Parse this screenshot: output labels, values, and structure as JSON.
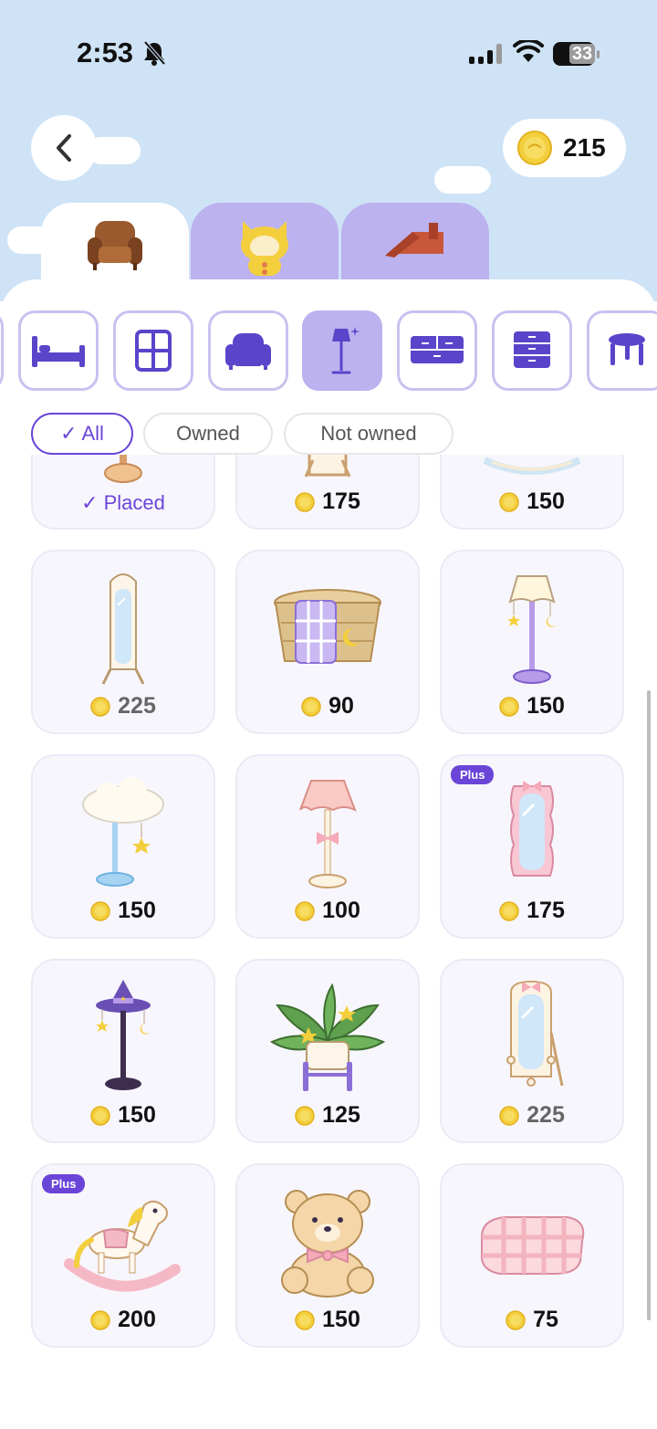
{
  "status_bar": {
    "time": "2:53",
    "battery": "33"
  },
  "header": {
    "coins": "215"
  },
  "tabs": [
    {
      "icon": "armchair-icon",
      "active": true
    },
    {
      "icon": "cat-avatar-icon",
      "active": false
    },
    {
      "icon": "roof-icon",
      "active": false
    }
  ],
  "categories": [
    {
      "icon": "bed-icon",
      "active": false
    },
    {
      "icon": "window-icon",
      "active": false
    },
    {
      "icon": "sofa-icon",
      "active": false
    },
    {
      "icon": "floor-lamp-icon",
      "active": true
    },
    {
      "icon": "dresser-icon",
      "active": false
    },
    {
      "icon": "cabinet-icon",
      "active": false
    },
    {
      "icon": "stool-icon",
      "active": false
    }
  ],
  "filters": {
    "all": "✓ All",
    "owned": "Owned",
    "not_owned": "Not owned"
  },
  "items": [
    {
      "icon": "lamp-base-item",
      "placed_label": "✓ Placed"
    },
    {
      "icon": "frame-mirror-item",
      "price": "175"
    },
    {
      "icon": "round-mirror-item",
      "price": "150"
    },
    {
      "icon": "standing-mirror-item",
      "price": "225"
    },
    {
      "icon": "blanket-basket-item",
      "price": "90"
    },
    {
      "icon": "star-moon-floor-lamp-item",
      "price": "150"
    },
    {
      "icon": "cloud-lamp-item",
      "price": "150"
    },
    {
      "icon": "pink-shade-lamp-item",
      "price": "100"
    },
    {
      "icon": "wavy-pink-mirror-item",
      "price": "175",
      "badge": "Plus"
    },
    {
      "icon": "witch-hat-lamp-item",
      "price": "150"
    },
    {
      "icon": "potted-plant-item",
      "price": "125"
    },
    {
      "icon": "bow-mirror-item",
      "price": "225"
    },
    {
      "icon": "rocking-horse-item",
      "price": "200",
      "badge": "Plus"
    },
    {
      "icon": "teddy-bear-item",
      "price": "150"
    },
    {
      "icon": "folded-blanket-item",
      "price": "75"
    }
  ],
  "colors": {
    "accent": "#6a45d8",
    "sky": "#cfe3f6",
    "tab_inactive": "#bcb2ef"
  }
}
